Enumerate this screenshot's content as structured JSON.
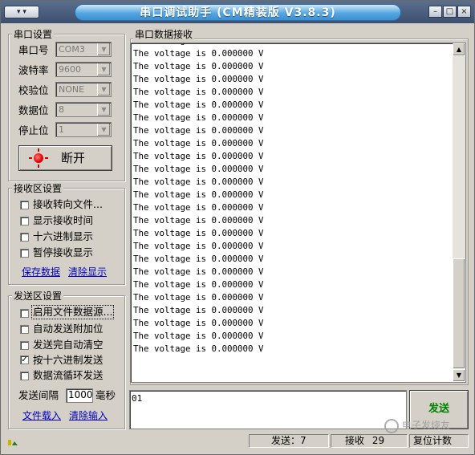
{
  "window": {
    "title": "串口调试助手 (CM精装版 V3.8.3)",
    "sysmenu_icon": "app-menu-icon",
    "minimize_icon": "minimize-icon",
    "maximize_icon": "maximize-icon",
    "close_icon": "close-icon"
  },
  "port_settings": {
    "title": "串口设置",
    "port_label": "串口号",
    "port_value": "COM3",
    "baud_label": "波特率",
    "baud_value": "9600",
    "parity_label": "校验位",
    "parity_value": "NONE",
    "databits_label": "数据位",
    "databits_value": "8",
    "stopbits_label": "停止位",
    "stopbits_value": "1",
    "toggle_button": "断开"
  },
  "receive_settings": {
    "title": "接收区设置",
    "options": [
      {
        "label": "接收转向文件...",
        "checked": false
      },
      {
        "label": "显示接收时间",
        "checked": false
      },
      {
        "label": "十六进制显示",
        "checked": false
      },
      {
        "label": "暂停接收显示",
        "checked": false
      }
    ],
    "save_link": "保存数据",
    "clear_link": "清除显示"
  },
  "send_settings": {
    "title": "发送区设置",
    "options": [
      {
        "label": "启用文件数据源...",
        "checked": false
      },
      {
        "label": "自动发送附加位",
        "checked": false
      },
      {
        "label": "发送完自动清空",
        "checked": false
      },
      {
        "label": "按十六进制发送",
        "checked": true
      },
      {
        "label": "数据流循环发送",
        "checked": false
      }
    ],
    "interval_label": "发送间隔",
    "interval_value": "1000",
    "interval_unit": "毫秒",
    "load_link": "文件载入",
    "clear_link": "清除输入"
  },
  "receive_area": {
    "title": "串口数据接收",
    "partial_top_line": "The voltage is 0.000000 V",
    "lines": [
      "The voltage is 0.000000 V",
      "The voltage is 0.000000 V",
      "The voltage is 0.000000 V",
      "The voltage is 0.000000 V",
      "The voltage is 0.000000 V",
      "The voltage is 0.000000 V",
      "The voltage is 0.000000 V",
      "The voltage is 0.000000 V",
      "The voltage is 0.000000 V",
      "The voltage is 0.000000 V",
      "The voltage is 0.000000 V",
      "The voltage is 0.000000 V",
      "The voltage is 0.000000 V",
      "The voltage is 0.000000 V",
      "The voltage is 0.000000 V",
      "The voltage is 0.000000 V",
      "The voltage is 0.000000 V",
      "The voltage is 0.000000 V",
      "The voltage is 0.000000 V",
      "The voltage is 0.000000 V",
      "The voltage is 0.000000 V",
      "The voltage is 0.000000 V",
      "The voltage is 0.000000 V",
      "The voltage is 0.000000 V"
    ]
  },
  "send_area": {
    "input_value": "01",
    "send_button": "发送"
  },
  "status_bar": {
    "send_count": "发送：7",
    "receive_label": "接收",
    "receive_value": "29",
    "reset_label": "复位计数",
    "watermark": "电子发烧友"
  }
}
